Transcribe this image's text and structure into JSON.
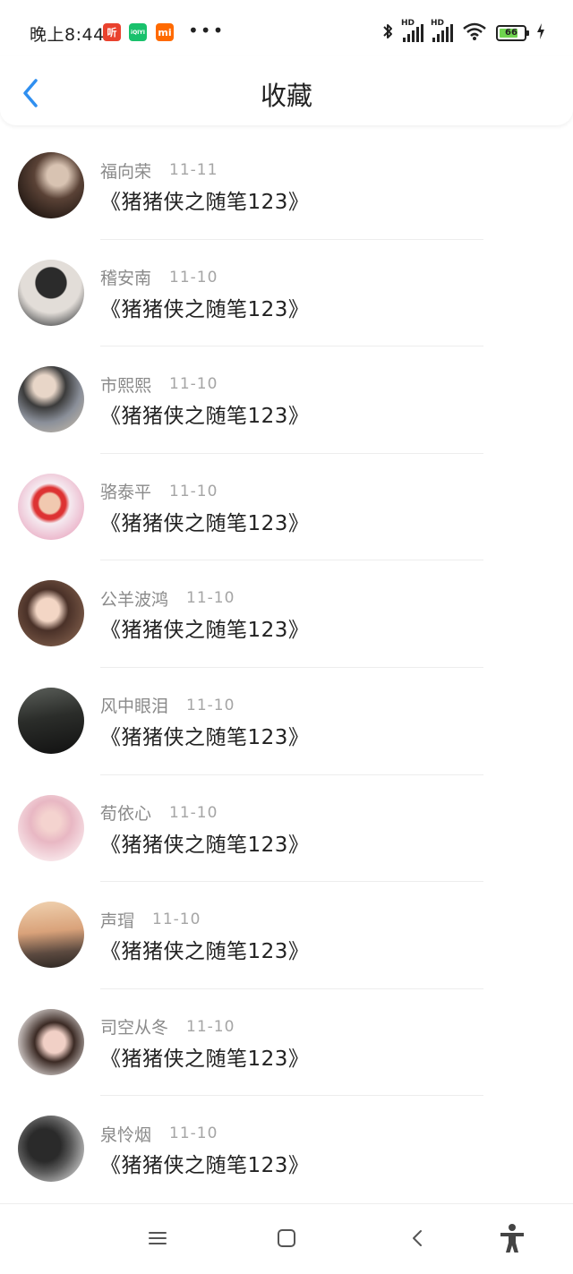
{
  "status_bar": {
    "time": "晚上8:44",
    "app_icons": [
      {
        "name": "ting-app-icon",
        "label": "听",
        "color": "#e9422e"
      },
      {
        "name": "iqiyi-app-icon",
        "label": "iQIYI",
        "color": "#19c16c"
      },
      {
        "name": "mi-app-icon",
        "label": "mi",
        "color": "#ff6a00"
      }
    ],
    "more": "•••",
    "hd_label": "HD",
    "battery_level": "66",
    "icons": [
      "bluetooth-icon",
      "signal-icon",
      "signal-icon",
      "wifi-icon",
      "battery-icon",
      "charging-icon"
    ]
  },
  "header": {
    "title": "收藏",
    "back_icon": "chevron-left-icon",
    "accent_color": "#2f8ff0"
  },
  "items": [
    {
      "username": "福向荣",
      "date": "11-11",
      "title": "《猪猪侠之随笔123》"
    },
    {
      "username": "稽安南",
      "date": "11-10",
      "title": "《猪猪侠之随笔123》"
    },
    {
      "username": "市熙熙",
      "date": "11-10",
      "title": "《猪猪侠之随笔123》"
    },
    {
      "username": "骆泰平",
      "date": "11-10",
      "title": "《猪猪侠之随笔123》"
    },
    {
      "username": "公羊波鸿",
      "date": "11-10",
      "title": "《猪猪侠之随笔123》"
    },
    {
      "username": "风中眼泪",
      "date": "11-10",
      "title": "《猪猪侠之随笔123》"
    },
    {
      "username": "荀依心",
      "date": "11-10",
      "title": "《猪猪侠之随笔123》"
    },
    {
      "username": "声瑁",
      "date": "11-10",
      "title": "《猪猪侠之随笔123》"
    },
    {
      "username": "司空从冬",
      "date": "11-10",
      "title": "《猪猪侠之随笔123》"
    },
    {
      "username": "泉怜烟",
      "date": "11-10",
      "title": "《猪猪侠之随笔123》"
    }
  ],
  "nav_bar": {
    "icons": [
      "menu-icon",
      "home-icon",
      "back-icon",
      "accessibility-icon"
    ]
  }
}
